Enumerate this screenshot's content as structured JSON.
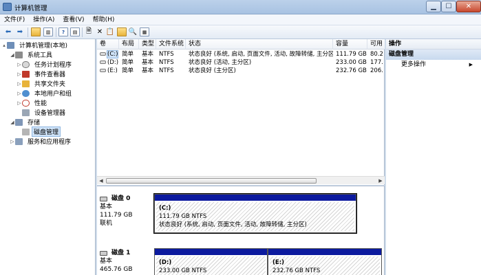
{
  "window": {
    "title": "计算机管理"
  },
  "menu": [
    "文件(F)",
    "操作(A)",
    "查看(V)",
    "帮助(H)"
  ],
  "tree": [
    {
      "label": "计算机管理(本地)",
      "level": 0
    },
    {
      "label": "系统工具",
      "level": 1
    },
    {
      "label": "任务计划程序",
      "level": 2
    },
    {
      "label": "事件查看器",
      "level": 2
    },
    {
      "label": "共享文件夹",
      "level": 2
    },
    {
      "label": "本地用户和组",
      "level": 2
    },
    {
      "label": "性能",
      "level": 2
    },
    {
      "label": "设备管理器",
      "level": 2
    },
    {
      "label": "存储",
      "level": 1
    },
    {
      "label": "磁盘管理",
      "level": 2
    },
    {
      "label": "服务和应用程序",
      "level": 1
    }
  ],
  "volumes": {
    "headers": [
      "卷",
      "布局",
      "类型",
      "文件系统",
      "状态",
      "容量",
      "可用"
    ],
    "rows": [
      {
        "name": "(C:)",
        "layout": "简单",
        "type": "基本",
        "fs": "NTFS",
        "status": "状态良好 (系统, 启动, 页面文件, 活动, 故障转储, 主分区)",
        "capacity": "111.79 GB",
        "free": "80.2"
      },
      {
        "name": "(D:)",
        "layout": "简单",
        "type": "基本",
        "fs": "NTFS",
        "status": "状态良好 (活动, 主分区)",
        "capacity": "233.00 GB",
        "free": "177."
      },
      {
        "name": "(E:)",
        "layout": "简单",
        "type": "基本",
        "fs": "NTFS",
        "status": "状态良好 (主分区)",
        "capacity": "232.76 GB",
        "free": "206."
      }
    ]
  },
  "disks": [
    {
      "name": "磁盘 0",
      "kind": "基本",
      "size": "111.79 GB",
      "state": "联机",
      "partitions": [
        {
          "name": "(C:)",
          "size": "111.79 GB NTFS",
          "status": "状态良好 (系统, 启动, 页面文件, 活动, 故障转储, 主分区)"
        }
      ]
    },
    {
      "name": "磁盘 1",
      "kind": "基本",
      "size": "465.76 GB",
      "state": "",
      "partitions": [
        {
          "name": "(D:)",
          "size": "233.00 GB NTFS",
          "status": ""
        },
        {
          "name": "(E:)",
          "size": "232.76 GB NTFS",
          "status": ""
        }
      ]
    }
  ],
  "actions": {
    "header": "操作",
    "section": "磁盘管理",
    "more": "更多操作"
  }
}
